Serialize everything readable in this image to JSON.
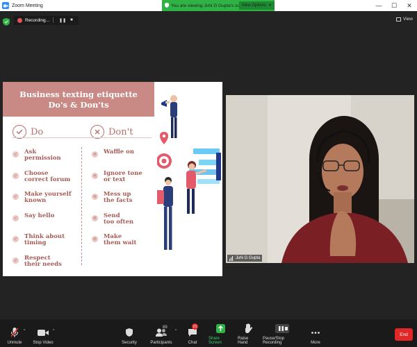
{
  "window": {
    "title": "Zoom Meeting",
    "viewing_banner": "You are viewing Juhi G Gupta's screen",
    "view_options_label": "View Options",
    "minimize": "—",
    "maximize": "☐",
    "close": "✕"
  },
  "recording": {
    "label": "Recording...",
    "pause": "❚❚",
    "stop": "■"
  },
  "view_button_label": "View",
  "slide": {
    "title_line1": "Business texting etiquette",
    "title_line2": "Do's & Don'ts",
    "do_heading": "Do",
    "dont_heading": "Don't",
    "do_items": [
      "Ask\npermission",
      "Choose\ncorrect forum",
      "Make yourself\nknown",
      "Say hello",
      "Think about\ntiming",
      "Respect\ntheir needs"
    ],
    "dont_items": [
      "Waffle on",
      "Ignore tone\nor text",
      "Mess up\nthe facts",
      "Send\ntoo often",
      "Make\nthem wait"
    ],
    "colors": {
      "accent": "#c98a85",
      "text": "#a45c57"
    }
  },
  "webcam": {
    "participant_name": "Juhi G Gupta"
  },
  "toolbar": {
    "unmute_label": "Unmute",
    "stop_video_label": "Stop Video",
    "security_label": "Security",
    "participants_label": "Participants",
    "participants_count": "89",
    "chat_label": "Chat",
    "chat_badge": "21",
    "share_screen_label": "Share Screen",
    "raise_hand_label": "Raise Hand",
    "recording_label": "Pause/Stop Recording",
    "more_label": "More",
    "end_label": "End",
    "caret": "^"
  }
}
